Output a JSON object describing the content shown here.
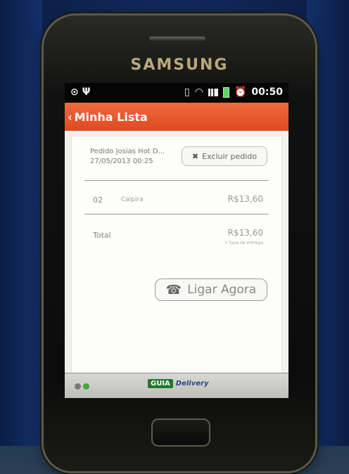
{
  "device": {
    "brand": "SAMSUNG"
  },
  "status_bar": {
    "left_icons": [
      "notification-icon",
      "usb-icon"
    ],
    "right_icons": [
      "vibrate-icon",
      "wifi-icon",
      "signal-icon",
      "battery-icon",
      "alarm-icon"
    ],
    "time": "00:50"
  },
  "action_bar": {
    "back_glyph": "‹",
    "title": "Minha Lista"
  },
  "order": {
    "name": "Pedido Josias Hot D...",
    "date": "27/05/2013 00:25",
    "delete_button": "Excluir pedido"
  },
  "items": [
    {
      "qty": "02",
      "name": "Caipira",
      "price": "R$13,60"
    }
  ],
  "totals": {
    "label": "Total",
    "value": "R$13,60",
    "note": "+ taxa de entrega"
  },
  "call_button": "Ligar Agora",
  "footer": {
    "logo_badge": "GUIA",
    "logo_word": "Delivery"
  },
  "colors": {
    "accent": "#e25326",
    "brand_green": "#1f7a2a",
    "brand_blue": "#244e7f"
  }
}
